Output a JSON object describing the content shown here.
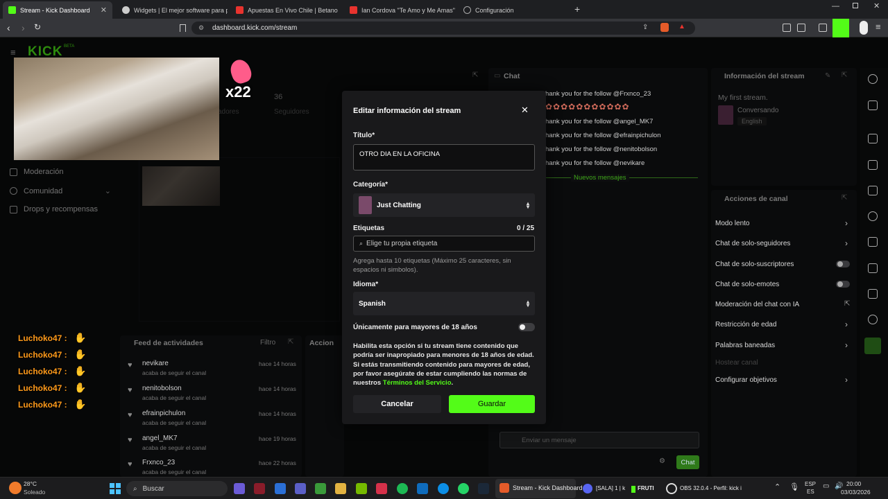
{
  "browser": {
    "tabs": [
      {
        "label": "Stream - Kick Dashboard",
        "color": "#53fc18",
        "active": true
      },
      {
        "label": "Widgets | El mejor software para pol",
        "color": "#cccccc"
      },
      {
        "label": "Apuestas En Vivo Chile | Betano",
        "color": "#e8332e"
      },
      {
        "label": "Ian Cordova \"Te Amo y Me Amas\" ( V",
        "color": "#e8332e"
      },
      {
        "label": "Configuración",
        "color": "#aaaaaa"
      }
    ],
    "new_tab": "+",
    "url": "dashboard.kick.com/stream"
  },
  "dashboard": {
    "logo": "KICK",
    "logo_badge": "BETA",
    "stats": {
      "followers_value": "36",
      "followers_label": "Seguidores",
      "viewers_label": "adores"
    },
    "sidebar": [
      {
        "label": "Moderación"
      },
      {
        "label": "Comunidad"
      },
      {
        "label": "Drops y recompensas"
      }
    ],
    "x22_text": "x22",
    "chat": {
      "title": "Chat",
      "lines": [
        "hank you for the follow @Frxnco_23",
        "hank you for the follow @angel_MK7",
        "hank you for the follow @efrainpichulon",
        "hank you for the follow @nenitobolson",
        "hank you for the follow @nevikare"
      ],
      "new_messages": "Nuevos mensajes",
      "input_placeholder": "Enviar un mensaje",
      "send_button": "Chat"
    },
    "stream_info": {
      "title": "Información del stream",
      "stream_title": "My first stream.",
      "category": "Conversando",
      "language": "English"
    },
    "channel_actions": {
      "title": "Acciones de canal",
      "items": [
        {
          "label": "Modo lento",
          "control": "chevron"
        },
        {
          "label": "Chat de solo-seguidores",
          "control": "chevron"
        },
        {
          "label": "Chat de solo-suscriptores",
          "control": "toggle"
        },
        {
          "label": "Chat de solo-emotes",
          "control": "toggle"
        },
        {
          "label": "Moderación del chat con IA",
          "control": "external"
        },
        {
          "label": "Restricción de edad",
          "control": "chevron"
        },
        {
          "label": "Palabras baneadas",
          "control": "chevron"
        },
        {
          "label": "Hostear canal",
          "control": "none"
        },
        {
          "label": "Configurar objetivos",
          "control": "chevron"
        }
      ]
    },
    "feed": {
      "title": "Feed de actividades",
      "filter": "Filtro",
      "actions_title": "Accion",
      "items": [
        {
          "name": "nevikare",
          "sub": "acaba de seguir el canal",
          "time": "hace 14 horas"
        },
        {
          "name": "nenitobolson",
          "sub": "acaba de seguir el canal",
          "time": "hace 14 horas"
        },
        {
          "name": "efrainpichulon",
          "sub": "acaba de seguir el canal",
          "time": "hace 14 horas"
        },
        {
          "name": "angel_MK7",
          "sub": "acaba de seguir el canal",
          "time": "hace 19 horas"
        },
        {
          "name": "Frxnco_23",
          "sub": "acaba de seguir el canal",
          "time": "hace 22 horas"
        }
      ]
    },
    "overlay_chat": [
      "Luchoko47 :",
      "Luchoko47 :",
      "Luchoko47 :",
      "Luchoko47 :",
      "Luchoko47 :"
    ]
  },
  "modal": {
    "title": "Editar información del stream",
    "title_label": "Título*",
    "title_value": "OTRO DIA EN LA OFICINA",
    "category_label": "Categoría*",
    "category_value": "Just Chatting",
    "tags_label": "Etiquetas",
    "tags_count": "0 / 25",
    "tags_placeholder": "Elige tu propia etiqueta",
    "tags_help": "Agrega hasta 10 etiquetas (Máximo 25 caracteres, sin espacios ni simbolos).",
    "language_label": "Idioma*",
    "language_value": "Spanish",
    "adult_label": "Únicamente para mayores de 18 años",
    "adult_help": "Habilita esta opción si tu stream tiene contenido que podría ser inapropiado para menores de 18 años de edad. Si estás transmitiendo contenido para mayores de edad, por favor asegúrate de estar cumpliendo las normas de nuestros",
    "terms_link": "Términos del Servicio",
    "terms_end": ".",
    "cancel": "Cancelar",
    "save": "Guardar"
  },
  "taskbar": {
    "weather_temp": "28°C",
    "weather_desc": "Soleado",
    "search": "Buscar",
    "apps": [
      {
        "label": "Stream - Kick Dashboard"
      },
      {
        "label": "[SALA] 1 | k"
      },
      {
        "label": "FRUTI"
      },
      {
        "label": "OBS 32.0.4 - Perfil: kick i"
      }
    ],
    "lang_top": "ESP",
    "lang_bottom": "ES",
    "time": "20:00",
    "date": "03/03/2026"
  },
  "colors": {
    "kick_green": "#53fc18",
    "overlay_name": "#ff9a1a"
  }
}
